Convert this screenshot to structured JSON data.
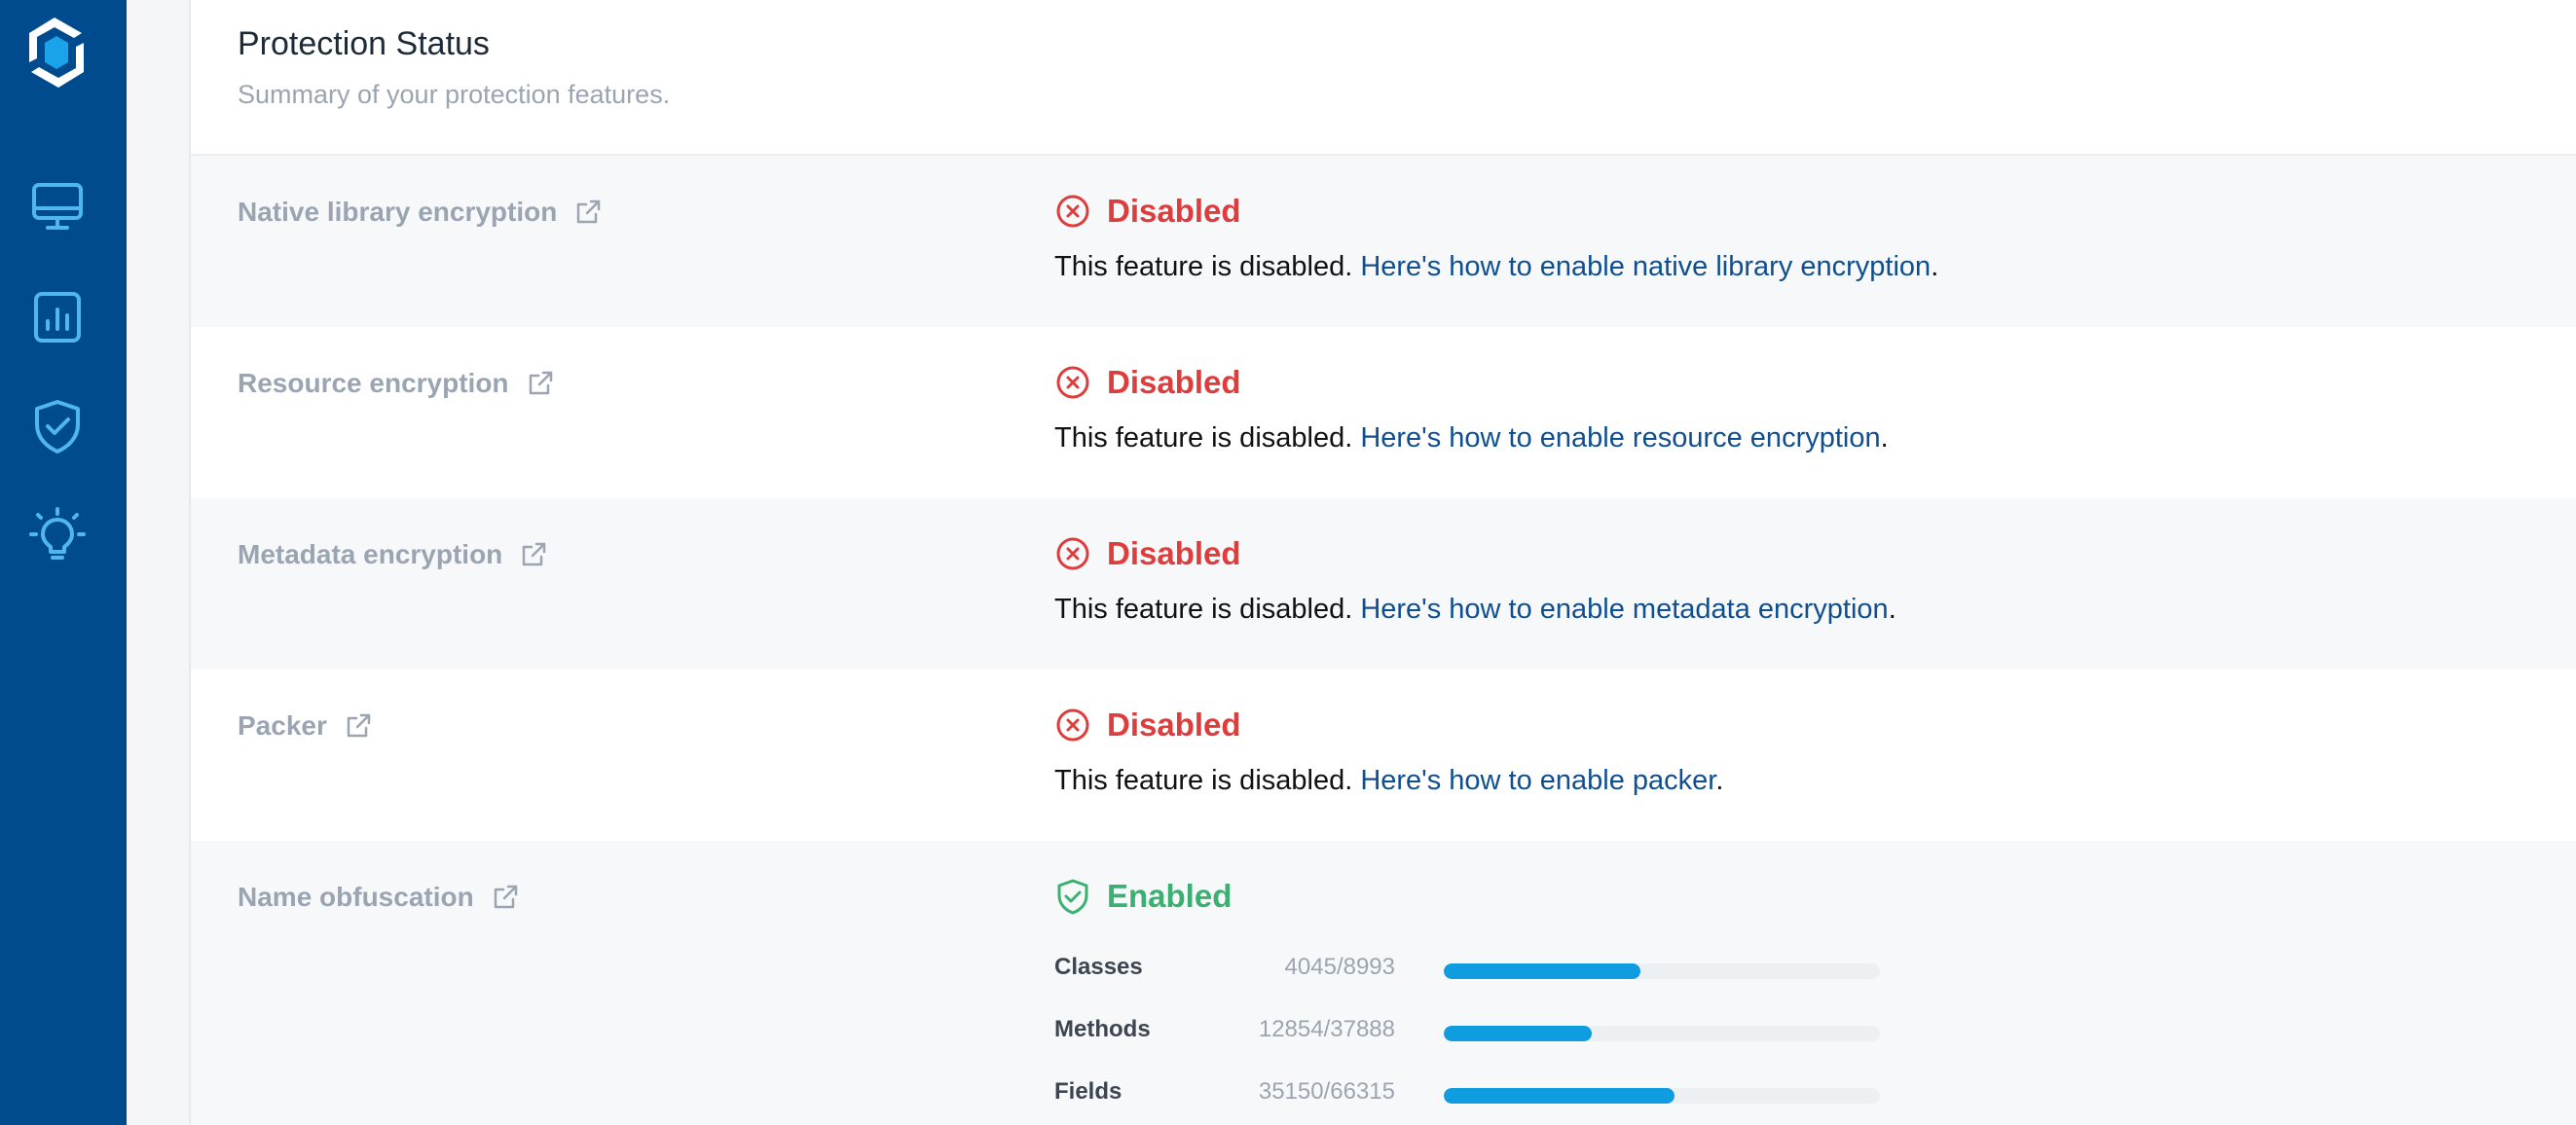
{
  "sidebar": {
    "logo": "logo-icon",
    "items": [
      {
        "name": "monitor-icon"
      },
      {
        "name": "chart-icon"
      },
      {
        "name": "shield-check-icon"
      },
      {
        "name": "lightbulb-icon"
      }
    ]
  },
  "header": {
    "title": "Protection Status",
    "subtitle": "Summary of your protection features."
  },
  "features": [
    {
      "name": "Native library encryption",
      "status": "Disabled",
      "desc_prefix": "This feature is disabled. ",
      "link": "Here's how to enable native library encryption",
      "desc_suffix": "."
    },
    {
      "name": "Resource encryption",
      "status": "Disabled",
      "desc_prefix": "This feature is disabled. ",
      "link": "Here's how to enable resource encryption",
      "desc_suffix": "."
    },
    {
      "name": "Metadata encryption",
      "status": "Disabled",
      "desc_prefix": "This feature is disabled. ",
      "link": "Here's how to enable metadata encryption",
      "desc_suffix": "."
    },
    {
      "name": "Packer",
      "status": "Disabled",
      "desc_prefix": "This feature is disabled. ",
      "link": "Here's how to enable packer",
      "desc_suffix": "."
    },
    {
      "name": "Name obfuscation",
      "status": "Enabled",
      "stats": [
        {
          "label": "Classes",
          "count": "4045/8993",
          "fraction": 0.4498
        },
        {
          "label": "Methods",
          "count": "12854/37888",
          "fraction": 0.3393
        },
        {
          "label": "Fields",
          "count": "35150/66315",
          "fraction": 0.53
        }
      ]
    }
  ],
  "colors": {
    "sidebar": "#004b8d",
    "disabled": "#dc3d3d",
    "enabled": "#3ab071",
    "link": "#0f4f8f",
    "progress": "#0f9ddf"
  }
}
